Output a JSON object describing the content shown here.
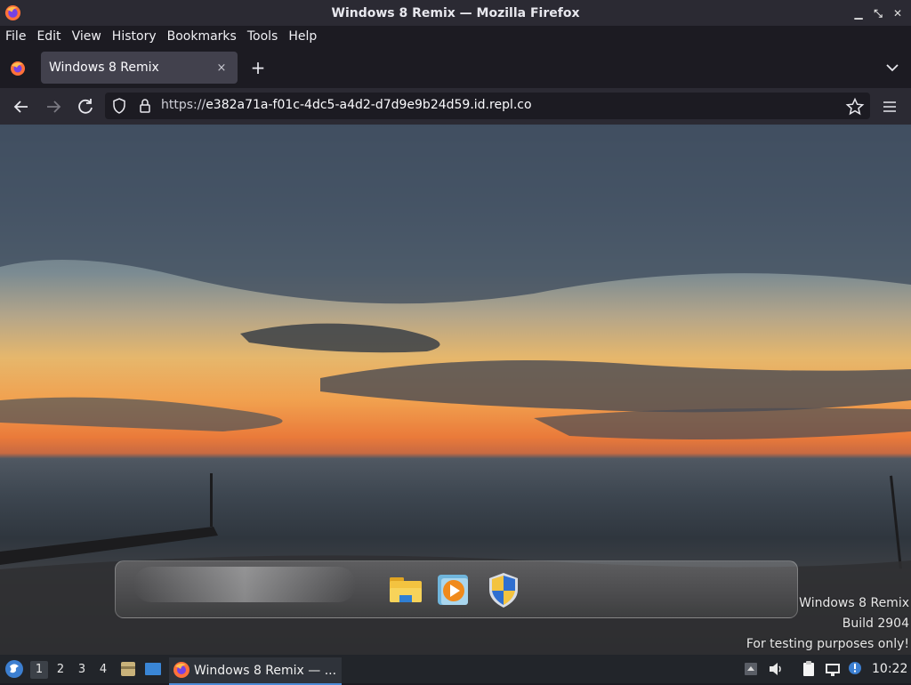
{
  "window": {
    "title": "Windows 8 Remix — Mozilla Firefox"
  },
  "menu": [
    "File",
    "Edit",
    "View",
    "History",
    "Bookmarks",
    "Tools",
    "Help"
  ],
  "tab": {
    "title": "Windows 8 Remix",
    "close": "×",
    "new": "+"
  },
  "address": {
    "prefix": "https://",
    "host": "e382a71a-f01c-4dc5-a4d2-d7d9e9b24d59.id.repl.co"
  },
  "watermark": {
    "line1": "Windows 8 Remix",
    "line2": "Build 2904",
    "line3": "For testing purposes only!"
  },
  "dock": {
    "items": [
      "file-explorer-icon",
      "media-player-icon",
      "security-shield-icon"
    ]
  },
  "taskbar": {
    "workspaces": [
      "1",
      "2",
      "3",
      "4"
    ],
    "active_task": "Windows 8 Remix — ...",
    "clock": "10:22"
  },
  "colors": {
    "accent": "#4b8bd6",
    "chrome_dark": "#1c1b22",
    "chrome_mid": "#2b2a33"
  }
}
